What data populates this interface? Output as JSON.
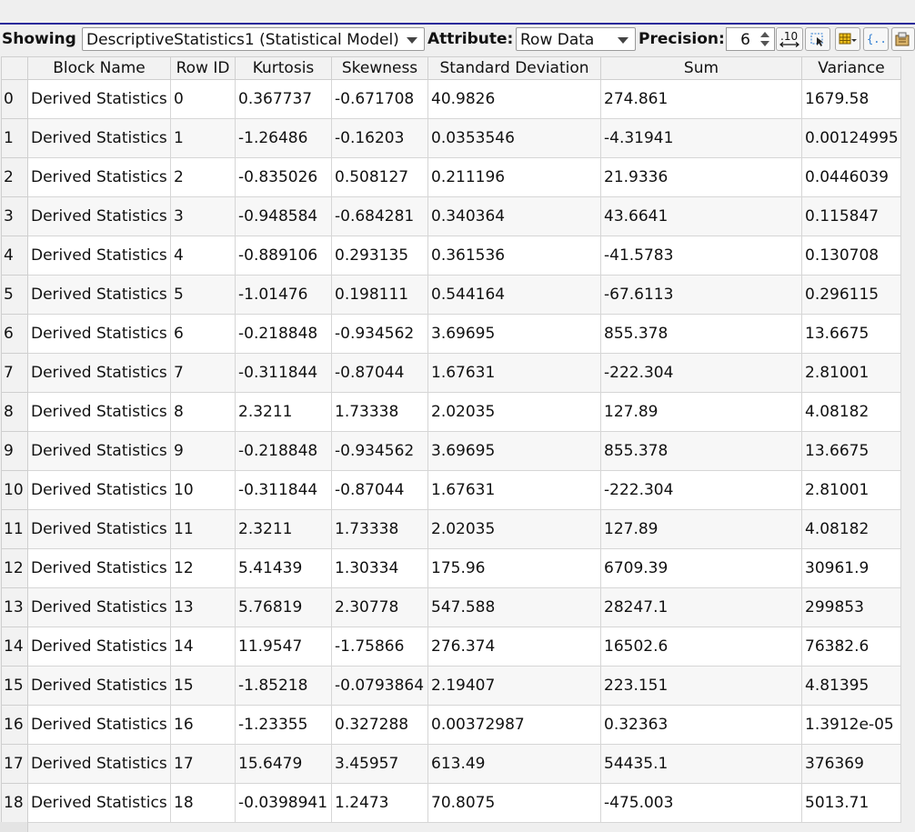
{
  "toolbar": {
    "showing_label": "Showing",
    "showing_value": "DescriptiveStatistics1 (Statistical Model)",
    "attribute_label": "Attribute:",
    "attribute_value": "Row Data",
    "precision_label": "Precision:",
    "precision_value": "6",
    "decimal_button_text": ".10"
  },
  "table": {
    "columns": [
      "Block Name",
      "Row ID",
      "Kurtosis",
      "Skewness",
      "Standard Deviation",
      "Sum",
      "Variance"
    ],
    "rows": [
      {
        "index": "0",
        "cells": [
          "Derived Statistics",
          "0",
          "0.367737",
          "-0.671708",
          "40.9826",
          "274.861",
          "1679.58"
        ]
      },
      {
        "index": "1",
        "cells": [
          "Derived Statistics",
          "1",
          "-1.26486",
          "-0.16203",
          "0.0353546",
          "-4.31941",
          "0.00124995"
        ]
      },
      {
        "index": "2",
        "cells": [
          "Derived Statistics",
          "2",
          "-0.835026",
          "0.508127",
          "0.211196",
          "21.9336",
          "0.0446039"
        ]
      },
      {
        "index": "3",
        "cells": [
          "Derived Statistics",
          "3",
          "-0.948584",
          "-0.684281",
          "0.340364",
          "43.6641",
          "0.115847"
        ]
      },
      {
        "index": "4",
        "cells": [
          "Derived Statistics",
          "4",
          "-0.889106",
          "0.293135",
          "0.361536",
          "-41.5783",
          "0.130708"
        ]
      },
      {
        "index": "5",
        "cells": [
          "Derived Statistics",
          "5",
          "-1.01476",
          "0.198111",
          "0.544164",
          "-67.6113",
          "0.296115"
        ]
      },
      {
        "index": "6",
        "cells": [
          "Derived Statistics",
          "6",
          "-0.218848",
          "-0.934562",
          "3.69695",
          "855.378",
          "13.6675"
        ]
      },
      {
        "index": "7",
        "cells": [
          "Derived Statistics",
          "7",
          "-0.311844",
          "-0.87044",
          "1.67631",
          "-222.304",
          "2.81001"
        ]
      },
      {
        "index": "8",
        "cells": [
          "Derived Statistics",
          "8",
          "2.3211",
          "1.73338",
          "2.02035",
          "127.89",
          "4.08182"
        ]
      },
      {
        "index": "9",
        "cells": [
          "Derived Statistics",
          "9",
          "-0.218848",
          "-0.934562",
          "3.69695",
          "855.378",
          "13.6675"
        ]
      },
      {
        "index": "10",
        "cells": [
          "Derived Statistics",
          "10",
          "-0.311844",
          "-0.87044",
          "1.67631",
          "-222.304",
          "2.81001"
        ]
      },
      {
        "index": "11",
        "cells": [
          "Derived Statistics",
          "11",
          "2.3211",
          "1.73338",
          "2.02035",
          "127.89",
          "4.08182"
        ]
      },
      {
        "index": "12",
        "cells": [
          "Derived Statistics",
          "12",
          "5.41439",
          "1.30334",
          "175.96",
          "6709.39",
          "30961.9"
        ]
      },
      {
        "index": "13",
        "cells": [
          "Derived Statistics",
          "13",
          "5.76819",
          "2.30778",
          "547.588",
          "28247.1",
          "299853"
        ]
      },
      {
        "index": "14",
        "cells": [
          "Derived Statistics",
          "14",
          "11.9547",
          "-1.75866",
          "276.374",
          "16502.6",
          "76382.6"
        ]
      },
      {
        "index": "15",
        "cells": [
          "Derived Statistics",
          "15",
          "-1.85218",
          "-0.0793864",
          "2.19407",
          "223.151",
          "4.81395"
        ]
      },
      {
        "index": "16",
        "cells": [
          "Derived Statistics",
          "16",
          "-1.23355",
          "0.327288",
          "0.00372987",
          "0.32363",
          "1.3912e-05"
        ]
      },
      {
        "index": "17",
        "cells": [
          "Derived Statistics",
          "17",
          "15.6479",
          "3.45957",
          "613.49",
          "54435.1",
          "376369"
        ]
      },
      {
        "index": "18",
        "cells": [
          "Derived Statistics",
          "18",
          "-0.0398941",
          "1.2473",
          "70.8075",
          "-475.003",
          "5013.71"
        ]
      }
    ]
  },
  "icons": {
    "selection_button": "select-cells-icon",
    "color_button": "color-table-icon",
    "json_button": "braces-icon",
    "export_button": "export-icon"
  },
  "colors": {
    "accent_line": "#2a2a9a",
    "header_bg": "#f2f2f2",
    "alt_row_bg": "#f7f7f7"
  }
}
